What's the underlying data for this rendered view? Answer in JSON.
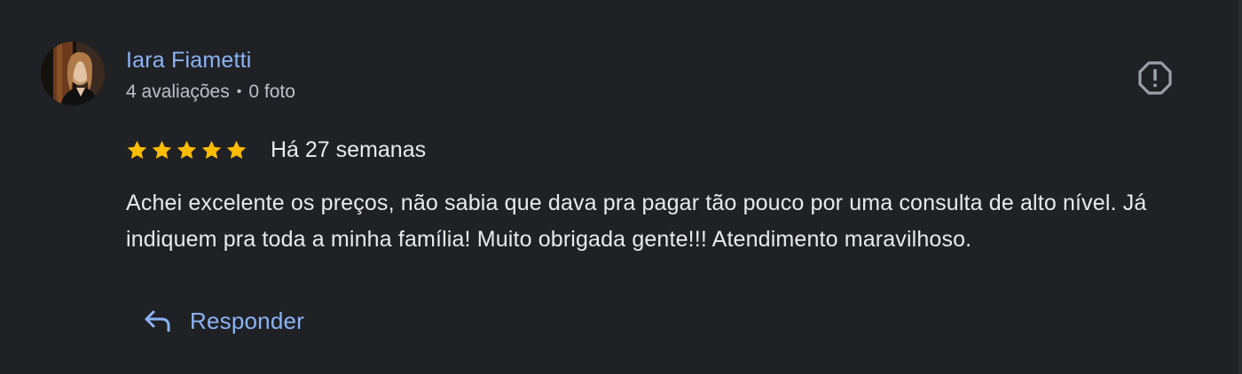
{
  "reviewer": {
    "name": "Iara Fiametti",
    "reviews_count": "4 avaliações",
    "separator": "•",
    "photos_count": "0 foto",
    "avatar_icon": "user-avatar-photo"
  },
  "review": {
    "rating": 5,
    "max_rating": 5,
    "date": "Há 27 semanas",
    "text": "Achei excelente os preços, não sabia que dava pra pagar tão pouco por uma consulta de alto nível. Já indiquem pra toda a minha família! Muito obrigada gente!!! Atendimento maravilhoso."
  },
  "actions": {
    "report_icon": "report-flag-icon",
    "reply_icon": "reply-arrow-icon",
    "reply_label": "Responder"
  },
  "colors": {
    "background": "#202124",
    "link": "#8ab4f8",
    "star": "#fbbc04",
    "text": "#e8eaed",
    "muted": "#bdc1c6",
    "icon": "#9aa0a6"
  }
}
